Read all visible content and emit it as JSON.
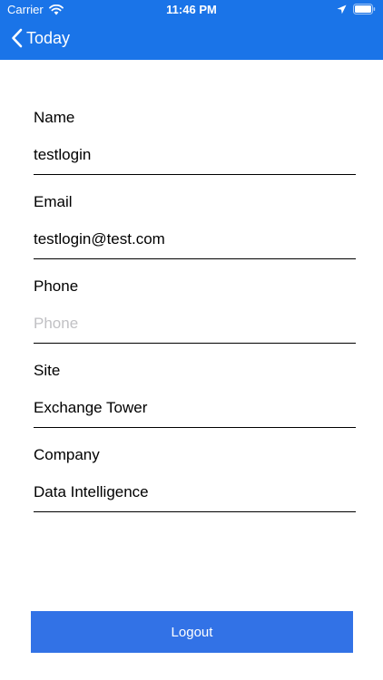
{
  "status_bar": {
    "carrier": "Carrier",
    "time": "11:46 PM",
    "icons": [
      "wifi-icon",
      "location-icon",
      "battery-icon"
    ]
  },
  "nav": {
    "back_label": "Today",
    "back_icon": "chevron-left-icon",
    "bar_color": "#1a74e8"
  },
  "form": {
    "fields": [
      {
        "label": "Name",
        "value": "testlogin",
        "placeholder": ""
      },
      {
        "label": "Email",
        "value": "testlogin@test.com",
        "placeholder": ""
      },
      {
        "label": "Phone",
        "value": "",
        "placeholder": "Phone"
      },
      {
        "label": "Site",
        "value": "Exchange Tower",
        "placeholder": ""
      },
      {
        "label": "Company",
        "value": "Data Intelligence",
        "placeholder": ""
      }
    ]
  },
  "actions": {
    "logout_label": "Logout",
    "logout_color": "#3272e6"
  }
}
